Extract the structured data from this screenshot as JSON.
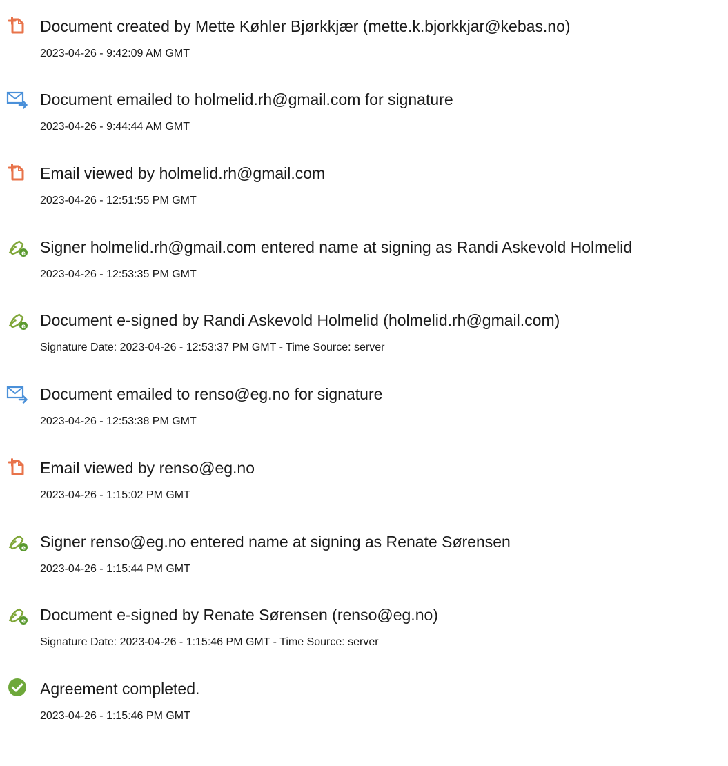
{
  "events": [
    {
      "icon": "document-created-icon",
      "title": "Document created by Mette Køhler Bjørkkjær (mette.k.bjorkkjar@kebas.no)",
      "detail": "2023-04-26 - 9:42:09 AM GMT"
    },
    {
      "icon": "email-sent-icon",
      "title": "Document emailed to holmelid.rh@gmail.com for signature",
      "detail": "2023-04-26 - 9:44:44 AM GMT"
    },
    {
      "icon": "document-viewed-icon",
      "title": "Email viewed by holmelid.rh@gmail.com",
      "detail": "2023-04-26 - 12:51:55 PM GMT"
    },
    {
      "icon": "e-sign-pen-icon",
      "title": "Signer holmelid.rh@gmail.com entered name at signing as Randi Askevold Holmelid",
      "detail": "2023-04-26 - 12:53:35 PM GMT"
    },
    {
      "icon": "e-sign-pen-icon",
      "title": "Document e-signed by Randi Askevold Holmelid (holmelid.rh@gmail.com)",
      "detail": "Signature Date: 2023-04-26 - 12:53:37 PM GMT - Time Source: server"
    },
    {
      "icon": "email-sent-icon",
      "title": "Document emailed to renso@eg.no for signature",
      "detail": "2023-04-26 - 12:53:38 PM GMT"
    },
    {
      "icon": "document-viewed-icon",
      "title": "Email viewed by renso@eg.no",
      "detail": "2023-04-26 - 1:15:02 PM GMT"
    },
    {
      "icon": "e-sign-pen-icon",
      "title": "Signer renso@eg.no entered name at signing as Renate Sørensen",
      "detail": "2023-04-26 - 1:15:44 PM GMT"
    },
    {
      "icon": "e-sign-pen-icon",
      "title": "Document e-signed by Renate Sørensen (renso@eg.no)",
      "detail": "Signature Date: 2023-04-26 - 1:15:46 PM GMT - Time Source: server"
    },
    {
      "icon": "agreement-completed-check-icon",
      "title": "Agreement completed.",
      "detail": "2023-04-26 - 1:15:46 PM GMT"
    }
  ],
  "colors": {
    "document_icon": "#e8734a",
    "email_icon": "#4a90d9",
    "esign_icon": "#7fa637",
    "complete_icon": "#6ea83a",
    "text": "#1a1a1a"
  }
}
